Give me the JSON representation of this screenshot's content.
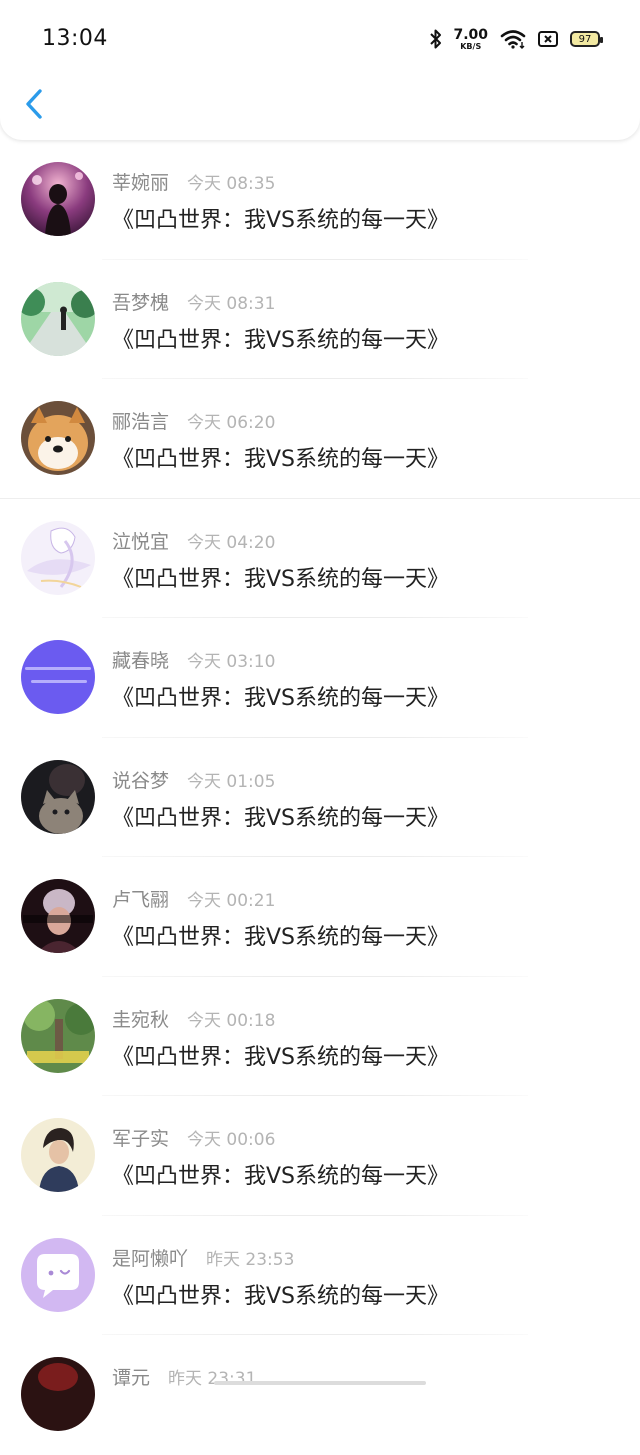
{
  "status_bar": {
    "time": "13:04",
    "net_speed_value": "7.00",
    "net_speed_unit": "KB/S",
    "battery": "97",
    "icons": [
      "bluetooth-icon",
      "wifi-icon",
      "sim-icon",
      "battery-icon"
    ]
  },
  "nav": {
    "back_icon": "chevron-left-icon",
    "accent_color": "#2b9bea"
  },
  "messages": [
    {
      "name": "莘婉丽",
      "time": "今天 08:35",
      "text": "《凹凸世界：我VS系统的每一天》"
    },
    {
      "name": "吾梦槐",
      "time": "今天 08:31",
      "text": "《凹凸世界：我VS系统的每一天》"
    },
    {
      "name": "郦浩言",
      "time": "今天 06:20",
      "text": "《凹凸世界：我VS系统的每一天》"
    },
    {
      "name": "泣悦宜",
      "time": "今天 04:20",
      "text": "《凹凸世界：我VS系统的每一天》"
    },
    {
      "name": "藏春晓",
      "time": "今天 03:10",
      "text": "《凹凸世界：我VS系统的每一天》"
    },
    {
      "name": "说谷梦",
      "time": "今天 01:05",
      "text": "《凹凸世界：我VS系统的每一天》"
    },
    {
      "name": "卢飞翮",
      "time": "今天 00:21",
      "text": "《凹凸世界：我VS系统的每一天》"
    },
    {
      "name": "圭宛秋",
      "time": "今天 00:18",
      "text": "《凹凸世界：我VS系统的每一天》"
    },
    {
      "name": "军子实",
      "time": "今天 00:06",
      "text": "《凹凸世界：我VS系统的每一天》"
    },
    {
      "name": "是阿懒吖",
      "time": "昨天 23:53",
      "text": "《凹凸世界：我VS系统的每一天》"
    },
    {
      "name": "谭元",
      "time": "昨天 23:31",
      "text": ""
    }
  ]
}
